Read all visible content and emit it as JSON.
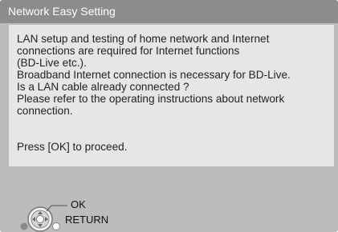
{
  "dialog": {
    "title": "Network Easy Setting",
    "message_lines": [
      "LAN setup and testing of home network and Internet",
      "connections are required for Internet functions",
      "(BD-Live etc.).",
      "Broadband Internet connection is necessary for BD-Live.",
      "Is a LAN cable already connected ?",
      "Please refer to the operating instructions about network",
      "connection.",
      "",
      "Press [OK] to proceed."
    ]
  },
  "controls": {
    "ok_label": "OK",
    "return_label": "RETURN"
  },
  "icons": {
    "remote": "remote-control-dpad-icon"
  },
  "colors": {
    "screen_background": "#bcbcbc",
    "title_bar": "#8c8c8c",
    "message_panel": "#e6e6e6",
    "text": "#222222"
  }
}
